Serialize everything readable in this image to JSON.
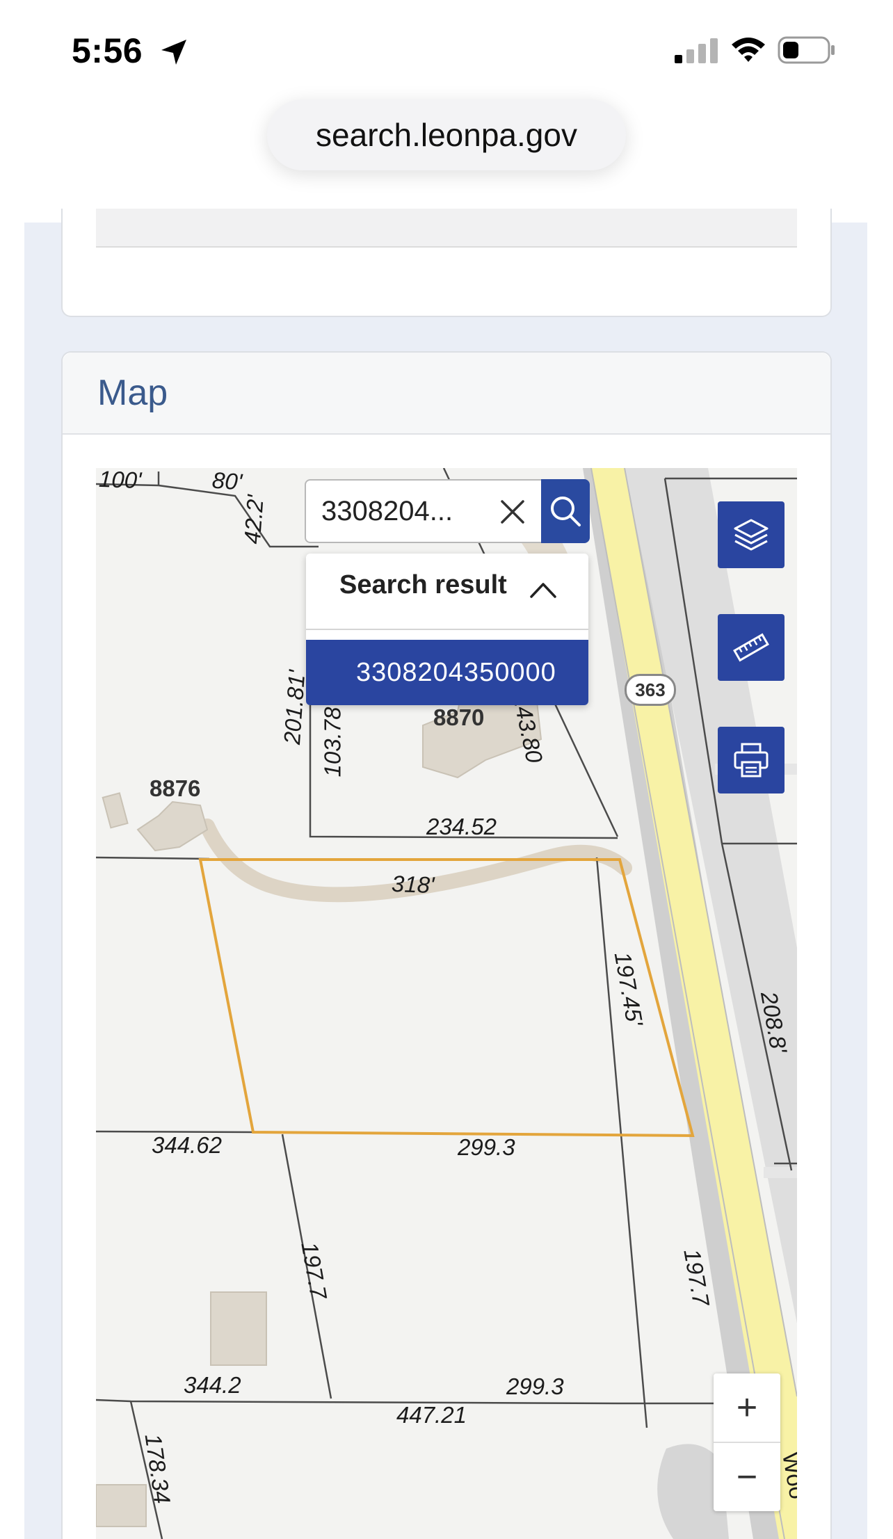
{
  "status_bar": {
    "time": "5:56"
  },
  "browser": {
    "url": "search.leonpa.gov"
  },
  "map_card": {
    "title": "Map"
  },
  "map": {
    "search_value": "3308204...",
    "results_title": "Search result",
    "result_item": "3308204350000",
    "road_shield": "363",
    "zoom_in": "+",
    "zoom_out": "−",
    "addresses": [
      "8870",
      "8876"
    ],
    "parcel_labels": [
      "100'",
      "80'",
      "42.2'",
      "201.81'",
      "103.78",
      "143.80",
      "234.52",
      "318'",
      "197.45'",
      "208.8'",
      "344.62",
      "299.3",
      "197.7",
      "197.7",
      "344.2",
      "299.3",
      "447.21",
      "178.34",
      "Woo"
    ]
  },
  "colors": {
    "accent": "#2a45a0",
    "title": "#3a5a8c",
    "road": "#f8f2a6",
    "parcel_highlight": "#e3a53c"
  }
}
